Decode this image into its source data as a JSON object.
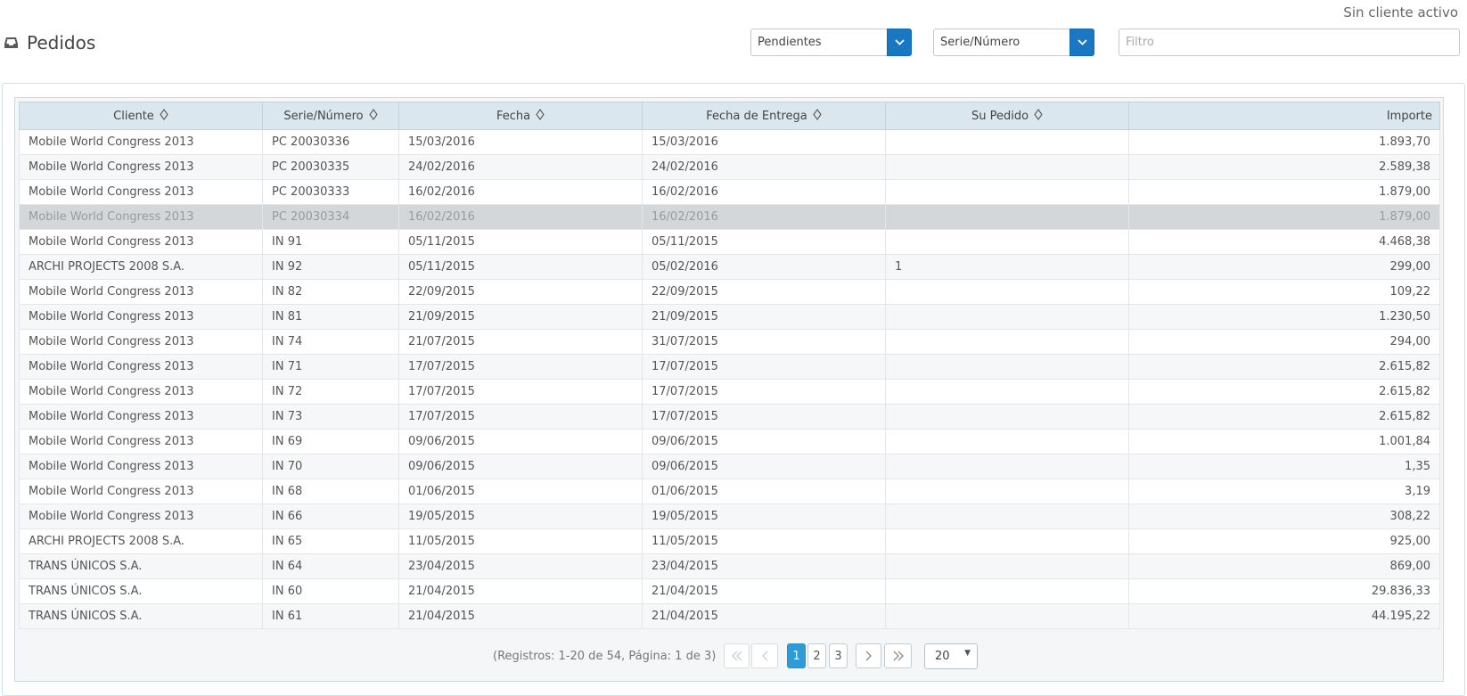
{
  "header": {
    "client_status": "Sin cliente activo",
    "title": "Pedidos",
    "icon": "inbox-icon"
  },
  "filters": {
    "status_value": "Pendientes",
    "field_value": "Serie/Número",
    "filter_placeholder": "Filtro"
  },
  "table": {
    "columns": [
      "Cliente",
      "Serie/Número",
      "Fecha",
      "Fecha de Entrega",
      "Su Pedido",
      "Importe"
    ],
    "rows": [
      [
        "Mobile World Congress 2013",
        "PC 20030336",
        "15/03/2016",
        "15/03/2016",
        "",
        "1.893,70"
      ],
      [
        "Mobile World Congress 2013",
        "PC 20030335",
        "24/02/2016",
        "24/02/2016",
        "",
        "2.589,38"
      ],
      [
        "Mobile World Congress 2013",
        "PC 20030333",
        "16/02/2016",
        "16/02/2016",
        "",
        "1.879,00"
      ],
      [
        "Mobile World Congress 2013",
        "PC 20030334",
        "16/02/2016",
        "16/02/2016",
        "",
        "1.879,00"
      ],
      [
        "Mobile World Congress 2013",
        "IN 91",
        "05/11/2015",
        "05/11/2015",
        "",
        "4.468,38"
      ],
      [
        "ARCHI PROJECTS 2008 S.A.",
        "IN 92",
        "05/11/2015",
        "05/02/2016",
        "1",
        "299,00"
      ],
      [
        "Mobile World Congress 2013",
        "IN 82",
        "22/09/2015",
        "22/09/2015",
        "",
        "109,22"
      ],
      [
        "Mobile World Congress 2013",
        "IN 81",
        "21/09/2015",
        "21/09/2015",
        "",
        "1.230,50"
      ],
      [
        "Mobile World Congress 2013",
        "IN 74",
        "21/07/2015",
        "31/07/2015",
        "",
        "294,00"
      ],
      [
        "Mobile World Congress 2013",
        "IN 71",
        "17/07/2015",
        "17/07/2015",
        "",
        "2.615,82"
      ],
      [
        "Mobile World Congress 2013",
        "IN 72",
        "17/07/2015",
        "17/07/2015",
        "",
        "2.615,82"
      ],
      [
        "Mobile World Congress 2013",
        "IN 73",
        "17/07/2015",
        "17/07/2015",
        "",
        "2.615,82"
      ],
      [
        "Mobile World Congress 2013",
        "IN 69",
        "09/06/2015",
        "09/06/2015",
        "",
        "1.001,84"
      ],
      [
        "Mobile World Congress 2013",
        "IN 70",
        "09/06/2015",
        "09/06/2015",
        "",
        "1,35"
      ],
      [
        "Mobile World Congress 2013",
        "IN 68",
        "01/06/2015",
        "01/06/2015",
        "",
        "3,19"
      ],
      [
        "Mobile World Congress 2013",
        "IN 66",
        "19/05/2015",
        "19/05/2015",
        "",
        "308,22"
      ],
      [
        "ARCHI PROJECTS 2008 S.A.",
        "IN 65",
        "11/05/2015",
        "11/05/2015",
        "",
        "925,00"
      ],
      [
        "TRANS ÚNICOS S.A.",
        "IN 64",
        "23/04/2015",
        "23/04/2015",
        "",
        "869,00"
      ],
      [
        "TRANS ÚNICOS S.A.",
        "IN 60",
        "21/04/2015",
        "21/04/2015",
        "",
        "29.836,33"
      ],
      [
        "TRANS ÚNICOS S.A.",
        "IN 61",
        "21/04/2015",
        "21/04/2015",
        "",
        "44.195,22"
      ]
    ],
    "selected_row": 3
  },
  "pager": {
    "info": "(Registros: 1-20 de 54, Página: 1 de 3)",
    "pages": [
      "1",
      "2",
      "3"
    ],
    "current_page": "1",
    "page_size": "20"
  },
  "colors": {
    "accent": "#1a78c2",
    "header_bg": "#dbe7ee",
    "selected_row": "#d4d7da",
    "active_page": "#2e9bd6"
  }
}
